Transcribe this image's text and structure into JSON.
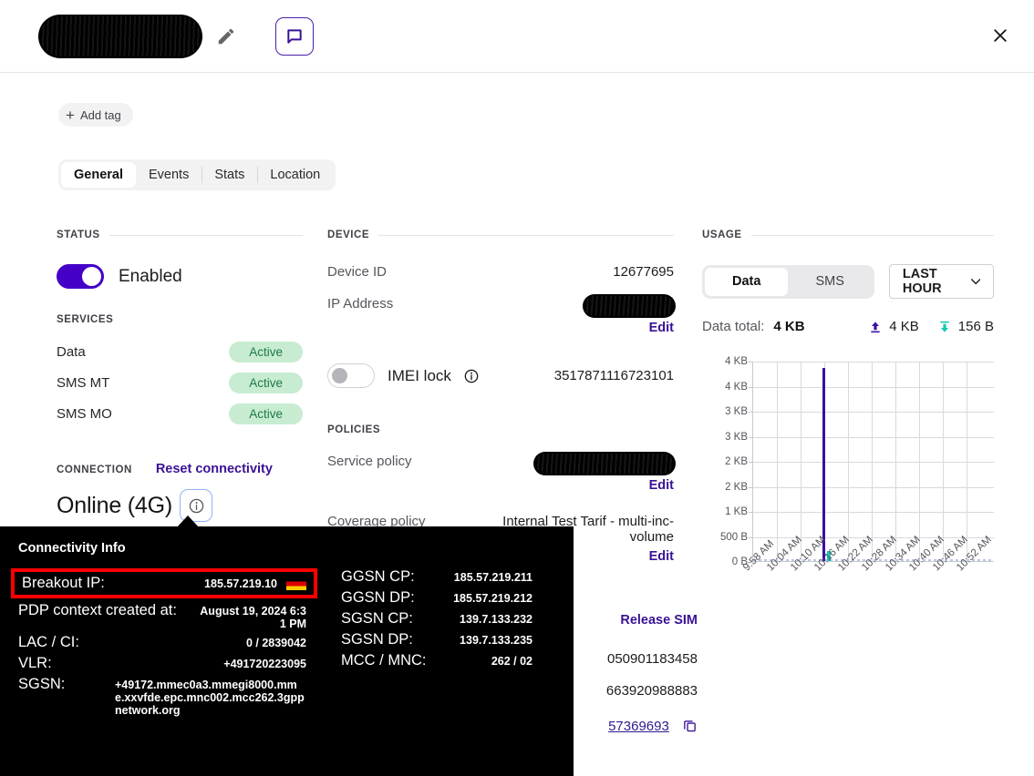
{
  "header": {
    "title_redacted": "",
    "edit_icon": "pencil-icon",
    "chat_icon": "comment-icon",
    "close_icon": "close-icon"
  },
  "tags": {
    "add_label": "Add tag",
    "plus": "+"
  },
  "tabs": [
    {
      "label": "General",
      "active": true
    },
    {
      "label": "Events",
      "active": false
    },
    {
      "label": "Stats",
      "active": false
    },
    {
      "label": "Location",
      "active": false
    }
  ],
  "status": {
    "heading": "STATUS",
    "toggle_state": "on",
    "toggle_label": "Enabled",
    "services_heading": "SERVICES",
    "services": [
      {
        "name": "Data",
        "state": "Active"
      },
      {
        "name": "SMS MT",
        "state": "Active"
      },
      {
        "name": "SMS MO",
        "state": "Active"
      }
    ],
    "connection_heading": "CONNECTION",
    "reset_link": "Reset connectivity",
    "connection_state": "Online (4G)",
    "info_icon": "info-icon"
  },
  "device": {
    "heading": "DEVICE",
    "device_id_label": "Device ID",
    "device_id_value": "12677695",
    "ip_label": "IP Address",
    "ip_value_redacted": "",
    "ip_edit": "Edit",
    "imei_label": "IMEI lock",
    "imei_info_icon": "info-icon",
    "imei_toggle_state": "off",
    "imei_value": "3517871116723101",
    "policies_heading": "POLICIES",
    "service_policy_label": "Service policy",
    "service_policy_redacted": "",
    "service_policy_edit": "Edit",
    "coverage_policy_label": "Coverage policy",
    "coverage_policy_value": "Internal Test Tarif - multi-inc-volume",
    "coverage_policy_edit": "Edit",
    "release_sim": "Release SIM",
    "partial_value_1": "050901183458",
    "partial_value_2": "663920988883",
    "partial_link": "57369693",
    "copy_icon": "copy-icon"
  },
  "usage": {
    "heading": "USAGE",
    "segments": [
      {
        "label": "Data",
        "active": true
      },
      {
        "label": "SMS",
        "active": false
      }
    ],
    "range_label": "LAST HOUR",
    "range_chevron": "chevron-down-icon",
    "total_label": "Data total:",
    "total_value": "4 KB",
    "upload_icon": "upload-icon",
    "upload_value": "4 KB",
    "download_icon": "download-icon",
    "download_value": "156 B"
  },
  "chart_data": {
    "type": "bar",
    "title": "",
    "xlabel": "",
    "ylabel": "",
    "grid": true,
    "legend": "none",
    "ytick_labels": [
      "4 KB",
      "4 KB",
      "3 KB",
      "3 KB",
      "2 KB",
      "2 KB",
      "1 KB",
      "500 B",
      "0 B"
    ],
    "ylim": [
      0,
      4096
    ],
    "xtick_labels": [
      "9:58 AM",
      "10:04 AM",
      "10:10 AM",
      "10:16 AM",
      "10:22 AM",
      "10:28 AM",
      "10:34 AM",
      "10:40 AM",
      "10:46 AM",
      "10:52 AM"
    ],
    "series": [
      {
        "name": "Upload",
        "color": "#3b0fa5",
        "x": "10:16 AM",
        "value": 3950,
        "unit": "B"
      },
      {
        "name": "Download",
        "color": "#14c8b4",
        "x": "10:16 AM",
        "value": 156,
        "unit": "B"
      }
    ]
  },
  "tooltip": {
    "title": "Connectivity Info",
    "left_rows": [
      {
        "key": "Breakout IP:",
        "value": "185.57.219.10",
        "flag": "de",
        "highlighted": true
      },
      {
        "key": "PDP context created at:",
        "value": "August 19, 2024 6:31 PM"
      },
      {
        "key": "LAC / CI:",
        "value": "0 / 2839042"
      },
      {
        "key": "VLR:",
        "value": "+491720223095"
      },
      {
        "key": "SGSN:",
        "value": "+49172.mmec0a3.mmegi8000.mme.xxvfde.epc.mnc002.mcc262.3gppnetwork.org"
      }
    ],
    "right_rows": [
      {
        "key": "GGSN CP:",
        "value": "185.57.219.211"
      },
      {
        "key": "GGSN DP:",
        "value": "185.57.219.212"
      },
      {
        "key": "SGSN CP:",
        "value": "139.7.133.232"
      },
      {
        "key": "SGSN DP:",
        "value": "139.7.133.235"
      },
      {
        "key": "MCC / MNC:",
        "value": "262 / 02"
      }
    ]
  },
  "colors": {
    "accent": "#4500c8",
    "link": "#3a1296",
    "badge_bg": "#c7ecd1",
    "badge_text": "#1d7a43",
    "upload": "#3b0fa5",
    "download": "#14c8b4",
    "highlight": "#ff0000"
  }
}
